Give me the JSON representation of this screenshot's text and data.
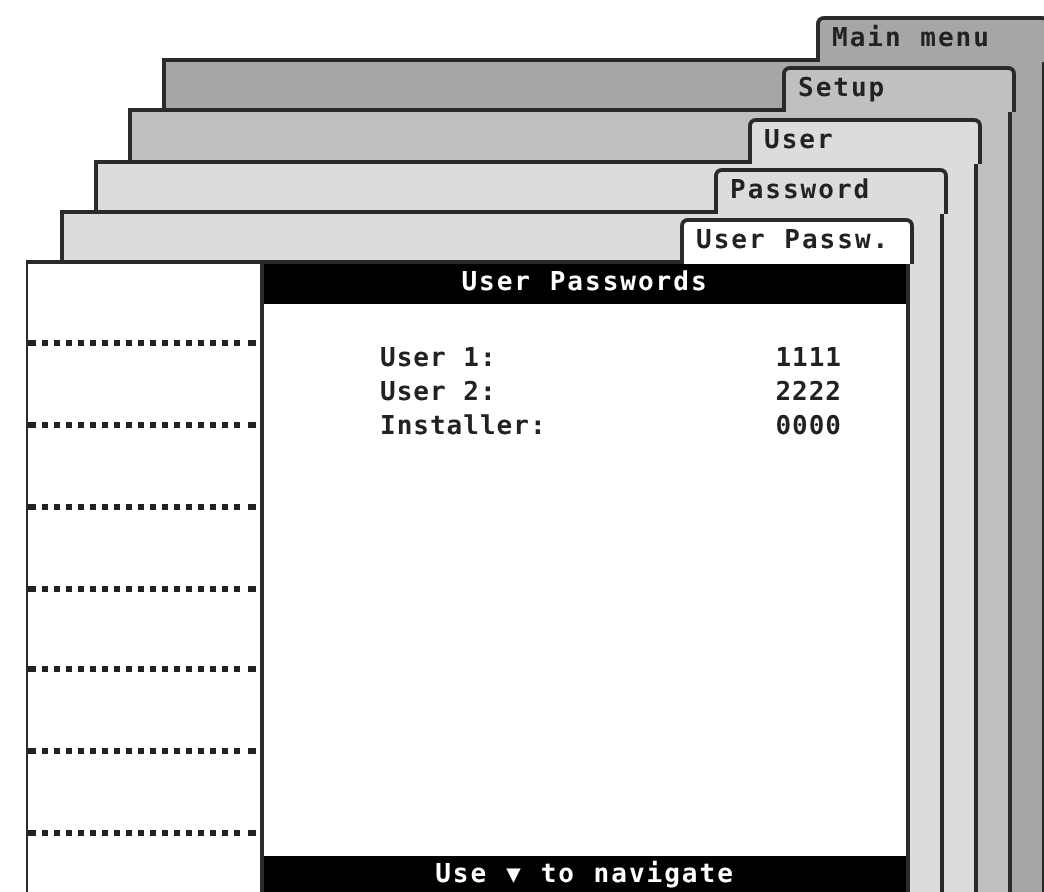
{
  "menu_stack": [
    {
      "title": "Main menu",
      "selected": false
    },
    {
      "title": "Setup",
      "selected": false
    },
    {
      "title": "User",
      "selected": false
    },
    {
      "title": "Password",
      "selected": false
    },
    {
      "title": "User Passw.",
      "selected": true
    }
  ],
  "screen": {
    "title": "User Passwords",
    "rows": [
      {
        "label": "User 1:",
        "value": "1111"
      },
      {
        "label": "User 2:",
        "value": "2222"
      },
      {
        "label": "Installer:",
        "value": "0000"
      }
    ],
    "footer": {
      "before": "Use",
      "arrow": "▼",
      "after": "to navigate"
    }
  }
}
